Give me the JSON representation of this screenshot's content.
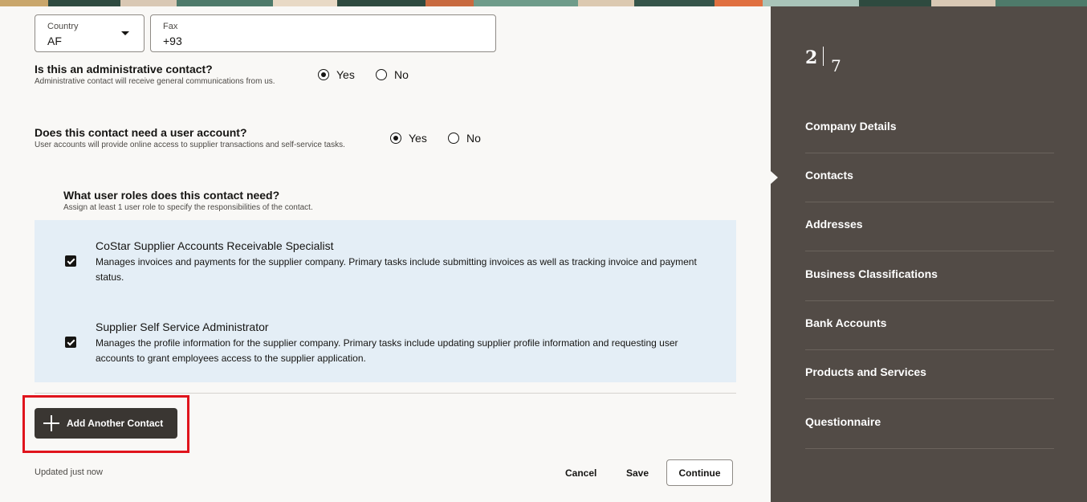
{
  "contact": {
    "country_label": "Country",
    "country_value": "AF",
    "fax_label": "Fax",
    "fax_value": "+93"
  },
  "admin_question": {
    "title": "Is this an administrative contact?",
    "subtitle": "Administrative contact will receive general communications from us.",
    "options": [
      "Yes",
      "No"
    ],
    "selected": "Yes"
  },
  "account_question": {
    "title": "Does this contact need a user account?",
    "subtitle": "User accounts will provide online access to supplier transactions and self-service tasks.",
    "options": [
      "Yes",
      "No"
    ],
    "selected": "Yes"
  },
  "roles": {
    "title": "What user roles does this contact need?",
    "subtitle": "Assign at least 1 user role to specify the responsibilities of the contact.",
    "items": [
      {
        "name": "CoStar Supplier Accounts Receivable Specialist",
        "description": "Manages invoices and payments for the supplier company. Primary tasks include submitting invoices as well as tracking invoice and payment status.",
        "checked": true
      },
      {
        "name": "Supplier Self Service Administrator",
        "description": "Manages the profile information for the supplier company. Primary tasks include updating supplier profile information and requesting user accounts to grant employees access to the supplier application.",
        "checked": true
      }
    ]
  },
  "actions": {
    "add_contact_label": "Add Another Contact",
    "updated_text": "Updated just now",
    "cancel_label": "Cancel",
    "save_label": "Save",
    "continue_label": "Continue"
  },
  "progress": {
    "current_step": "2",
    "total_steps": "7"
  },
  "sidebar": {
    "active": "Contacts",
    "items": [
      {
        "label": "Company Details"
      },
      {
        "label": "Contacts"
      },
      {
        "label": "Addresses"
      },
      {
        "label": "Business Classifications"
      },
      {
        "label": "Bank Accounts"
      },
      {
        "label": "Products and Services"
      },
      {
        "label": "Questionnaire"
      }
    ]
  },
  "colors": {
    "sidebar_bg": "#524b46",
    "primary_button": "#3a3632",
    "roles_panel_bg": "#e4eef6",
    "highlight_border": "#e0141c"
  }
}
